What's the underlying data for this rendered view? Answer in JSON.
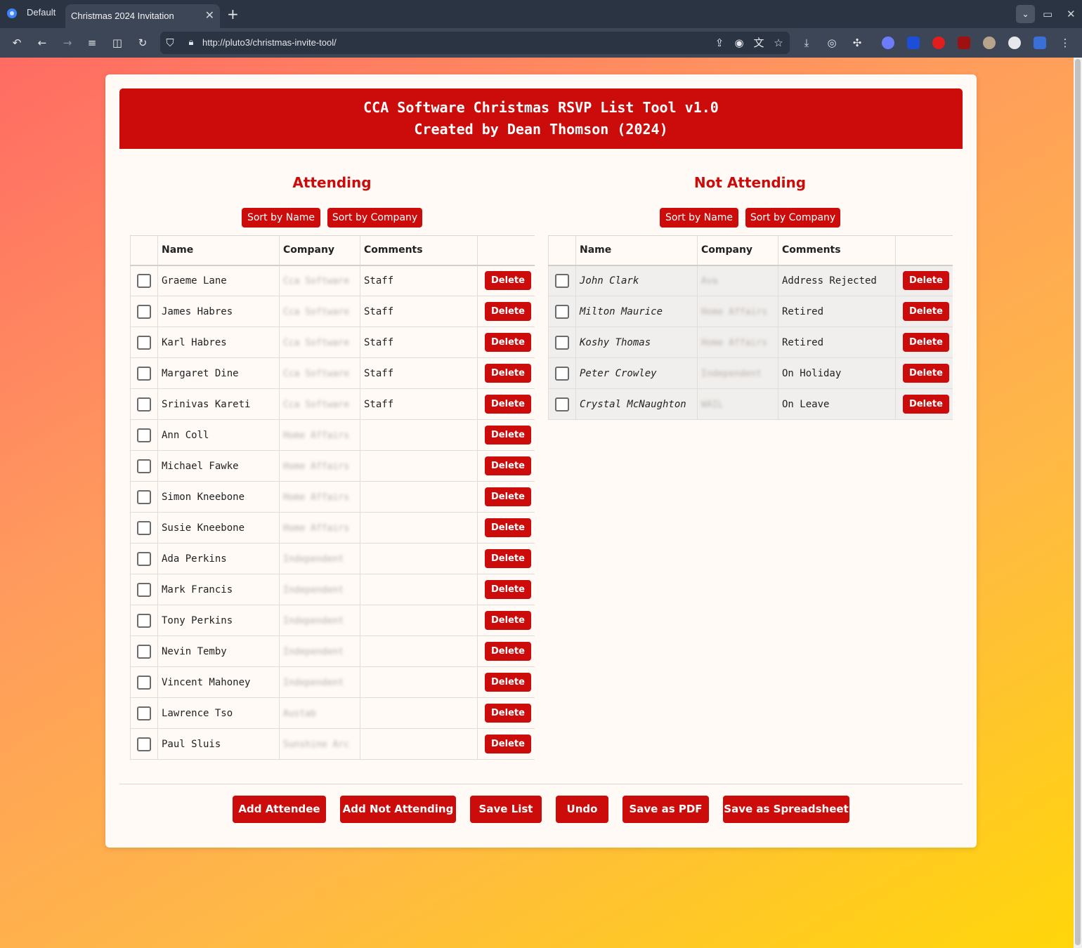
{
  "browser": {
    "profile": "Default",
    "tab_title": "Christmas 2024 Invitation",
    "url": "http://pluto3/christmas-invite-tool/"
  },
  "header": {
    "line1": "CCA Software Christmas RSVP List Tool v1.0",
    "line2": "Created by Dean Thomson (2024)"
  },
  "sort_by_name": "Sort by Name",
  "sort_by_company": "Sort by Company",
  "columns": {
    "name": "Name",
    "company": "Company",
    "comments": "Comments"
  },
  "delete_label": "Delete",
  "attending": {
    "title": "Attending",
    "rows": [
      {
        "name": "Graeme Lane",
        "company": "Cca Software",
        "comments": "Staff"
      },
      {
        "name": "James Habres",
        "company": "Cca Software",
        "comments": "Staff"
      },
      {
        "name": "Karl Habres",
        "company": "Cca Software",
        "comments": "Staff"
      },
      {
        "name": "Margaret Dine",
        "company": "Cca Software",
        "comments": "Staff"
      },
      {
        "name": "Srinivas Kareti",
        "company": "Cca Software",
        "comments": "Staff"
      },
      {
        "name": "Ann Coll",
        "company": "Home Affairs",
        "comments": ""
      },
      {
        "name": "Michael Fawke",
        "company": "Home Affairs",
        "comments": ""
      },
      {
        "name": "Simon Kneebone",
        "company": "Home Affairs",
        "comments": ""
      },
      {
        "name": "Susie Kneebone",
        "company": "Home Affairs",
        "comments": ""
      },
      {
        "name": "Ada Perkins",
        "company": "Independent",
        "comments": ""
      },
      {
        "name": "Mark Francis",
        "company": "Independent",
        "comments": ""
      },
      {
        "name": "Tony Perkins",
        "company": "Independent",
        "comments": ""
      },
      {
        "name": "Nevin Temby",
        "company": "Independent",
        "comments": ""
      },
      {
        "name": "Vincent Mahoney",
        "company": "Independent",
        "comments": ""
      },
      {
        "name": "Lawrence Tso",
        "company": "Austab",
        "comments": ""
      },
      {
        "name": "Paul Sluis",
        "company": "Sunshine Arc",
        "comments": ""
      }
    ]
  },
  "not_attending": {
    "title": "Not Attending",
    "rows": [
      {
        "name": "John Clark",
        "company": "Ava",
        "comments": "Address Rejected"
      },
      {
        "name": "Milton Maurice",
        "company": "Home Affairs",
        "comments": "Retired"
      },
      {
        "name": "Koshy Thomas",
        "company": "Home Affairs",
        "comments": "Retired"
      },
      {
        "name": "Peter Crowley",
        "company": "Independent",
        "comments": "On Holiday"
      },
      {
        "name": "Crystal McNaughton",
        "company": "WAIL",
        "comments": "On Leave"
      }
    ]
  },
  "actions": {
    "add_attendee": "Add Attendee",
    "add_not_attending": "Add Not Attending",
    "save_list": "Save List",
    "undo": "Undo",
    "save_pdf": "Save as PDF",
    "save_spreadsheet": "Save as Spreadsheet"
  }
}
